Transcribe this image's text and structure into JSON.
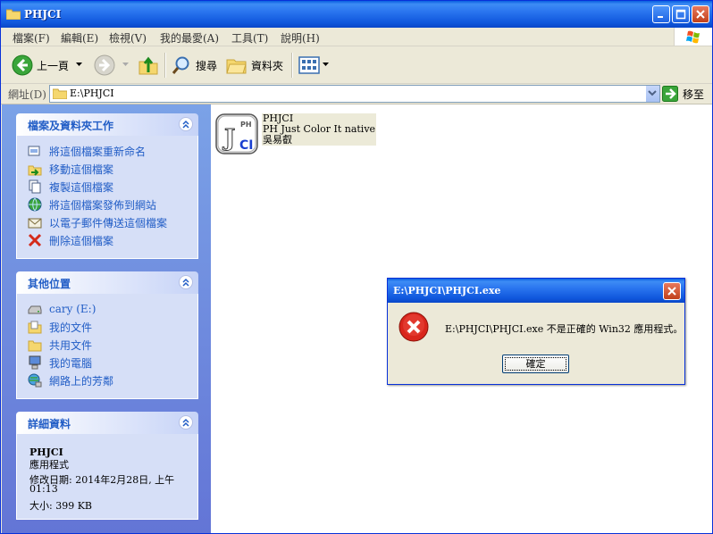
{
  "window": {
    "title": "PHJCI"
  },
  "menu": [
    "檔案(F)",
    "編輯(E)",
    "檢視(V)",
    "我的最愛(A)",
    "工具(T)",
    "說明(H)"
  ],
  "toolbar": {
    "back": "上一頁",
    "search": "搜尋",
    "folders": "資料夾"
  },
  "address": {
    "label": "網址(D)",
    "value": "E:\\PHJCI",
    "go": "移至"
  },
  "tasks_panel": {
    "title": "檔案及資料夾工作",
    "items": [
      "將這個檔案重新命名",
      "移動這個檔案",
      "複製這個檔案",
      "將這個檔案發佈到網站",
      "以電子郵件傳送這個檔案",
      "刪除這個檔案"
    ]
  },
  "places_panel": {
    "title": "其他位置",
    "items": [
      "cary (E:)",
      "我的文件",
      "共用文件",
      "我的電腦",
      "網路上的芳鄰"
    ]
  },
  "details_panel": {
    "title": "詳細資料",
    "name": "PHJCI",
    "type": "應用程式",
    "modified_line1": "修改日期: 2014年2月28日, 上午",
    "modified_line2": "01:13",
    "size": "大小: 399 KB"
  },
  "file": {
    "name": "PHJCI",
    "description": "PH Just Color It native",
    "company": "吳易叡",
    "icon_letters": {
      "ph": "PH",
      "j": "J",
      "ci": "CI"
    }
  },
  "dialog": {
    "title": "E:\\PHJCI\\PHJCI.exe",
    "message": "E:\\PHJCI\\PHJCI.exe 不是正確的 Win32 應用程式。",
    "ok": "確定"
  },
  "colors": {
    "title_blue": "#0a5fe0",
    "task_link": "#215dc6",
    "close_red": "#c1401a"
  }
}
